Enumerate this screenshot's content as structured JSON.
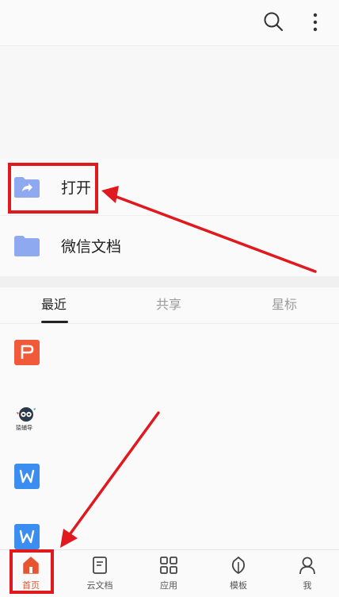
{
  "topbar": {
    "search_icon": "search-icon",
    "more_icon": "more-vertical-icon"
  },
  "folders": [
    {
      "label": "打开",
      "icon": "folder-share-icon"
    },
    {
      "label": "微信文档",
      "icon": "folder-icon"
    }
  ],
  "tabs": [
    {
      "label": "最近",
      "active": true
    },
    {
      "label": "共享",
      "active": false
    },
    {
      "label": "星标",
      "active": false
    }
  ],
  "recent_files": [
    {
      "type": "ppt",
      "icon": "ppt-file-icon",
      "color": "#f05a3b"
    },
    {
      "type": "image",
      "icon": "mascot-image-icon",
      "caption": "猿辅导"
    },
    {
      "type": "word",
      "icon": "word-file-icon",
      "color": "#3b8ef0"
    },
    {
      "type": "word",
      "icon": "word-file-icon",
      "color": "#3b8ef0"
    }
  ],
  "bottom_nav": [
    {
      "label": "首页",
      "icon": "home-icon",
      "active": true
    },
    {
      "label": "云文档",
      "icon": "cloud-doc-icon",
      "active": false
    },
    {
      "label": "应用",
      "icon": "apps-grid-icon",
      "active": false
    },
    {
      "label": "模板",
      "icon": "template-leaf-icon",
      "active": false
    },
    {
      "label": "我",
      "icon": "user-icon",
      "active": false
    }
  ],
  "colors": {
    "accent": "#e8542f",
    "annotation_red": "#e0191f",
    "folder_blue": "#8fa9f0"
  }
}
